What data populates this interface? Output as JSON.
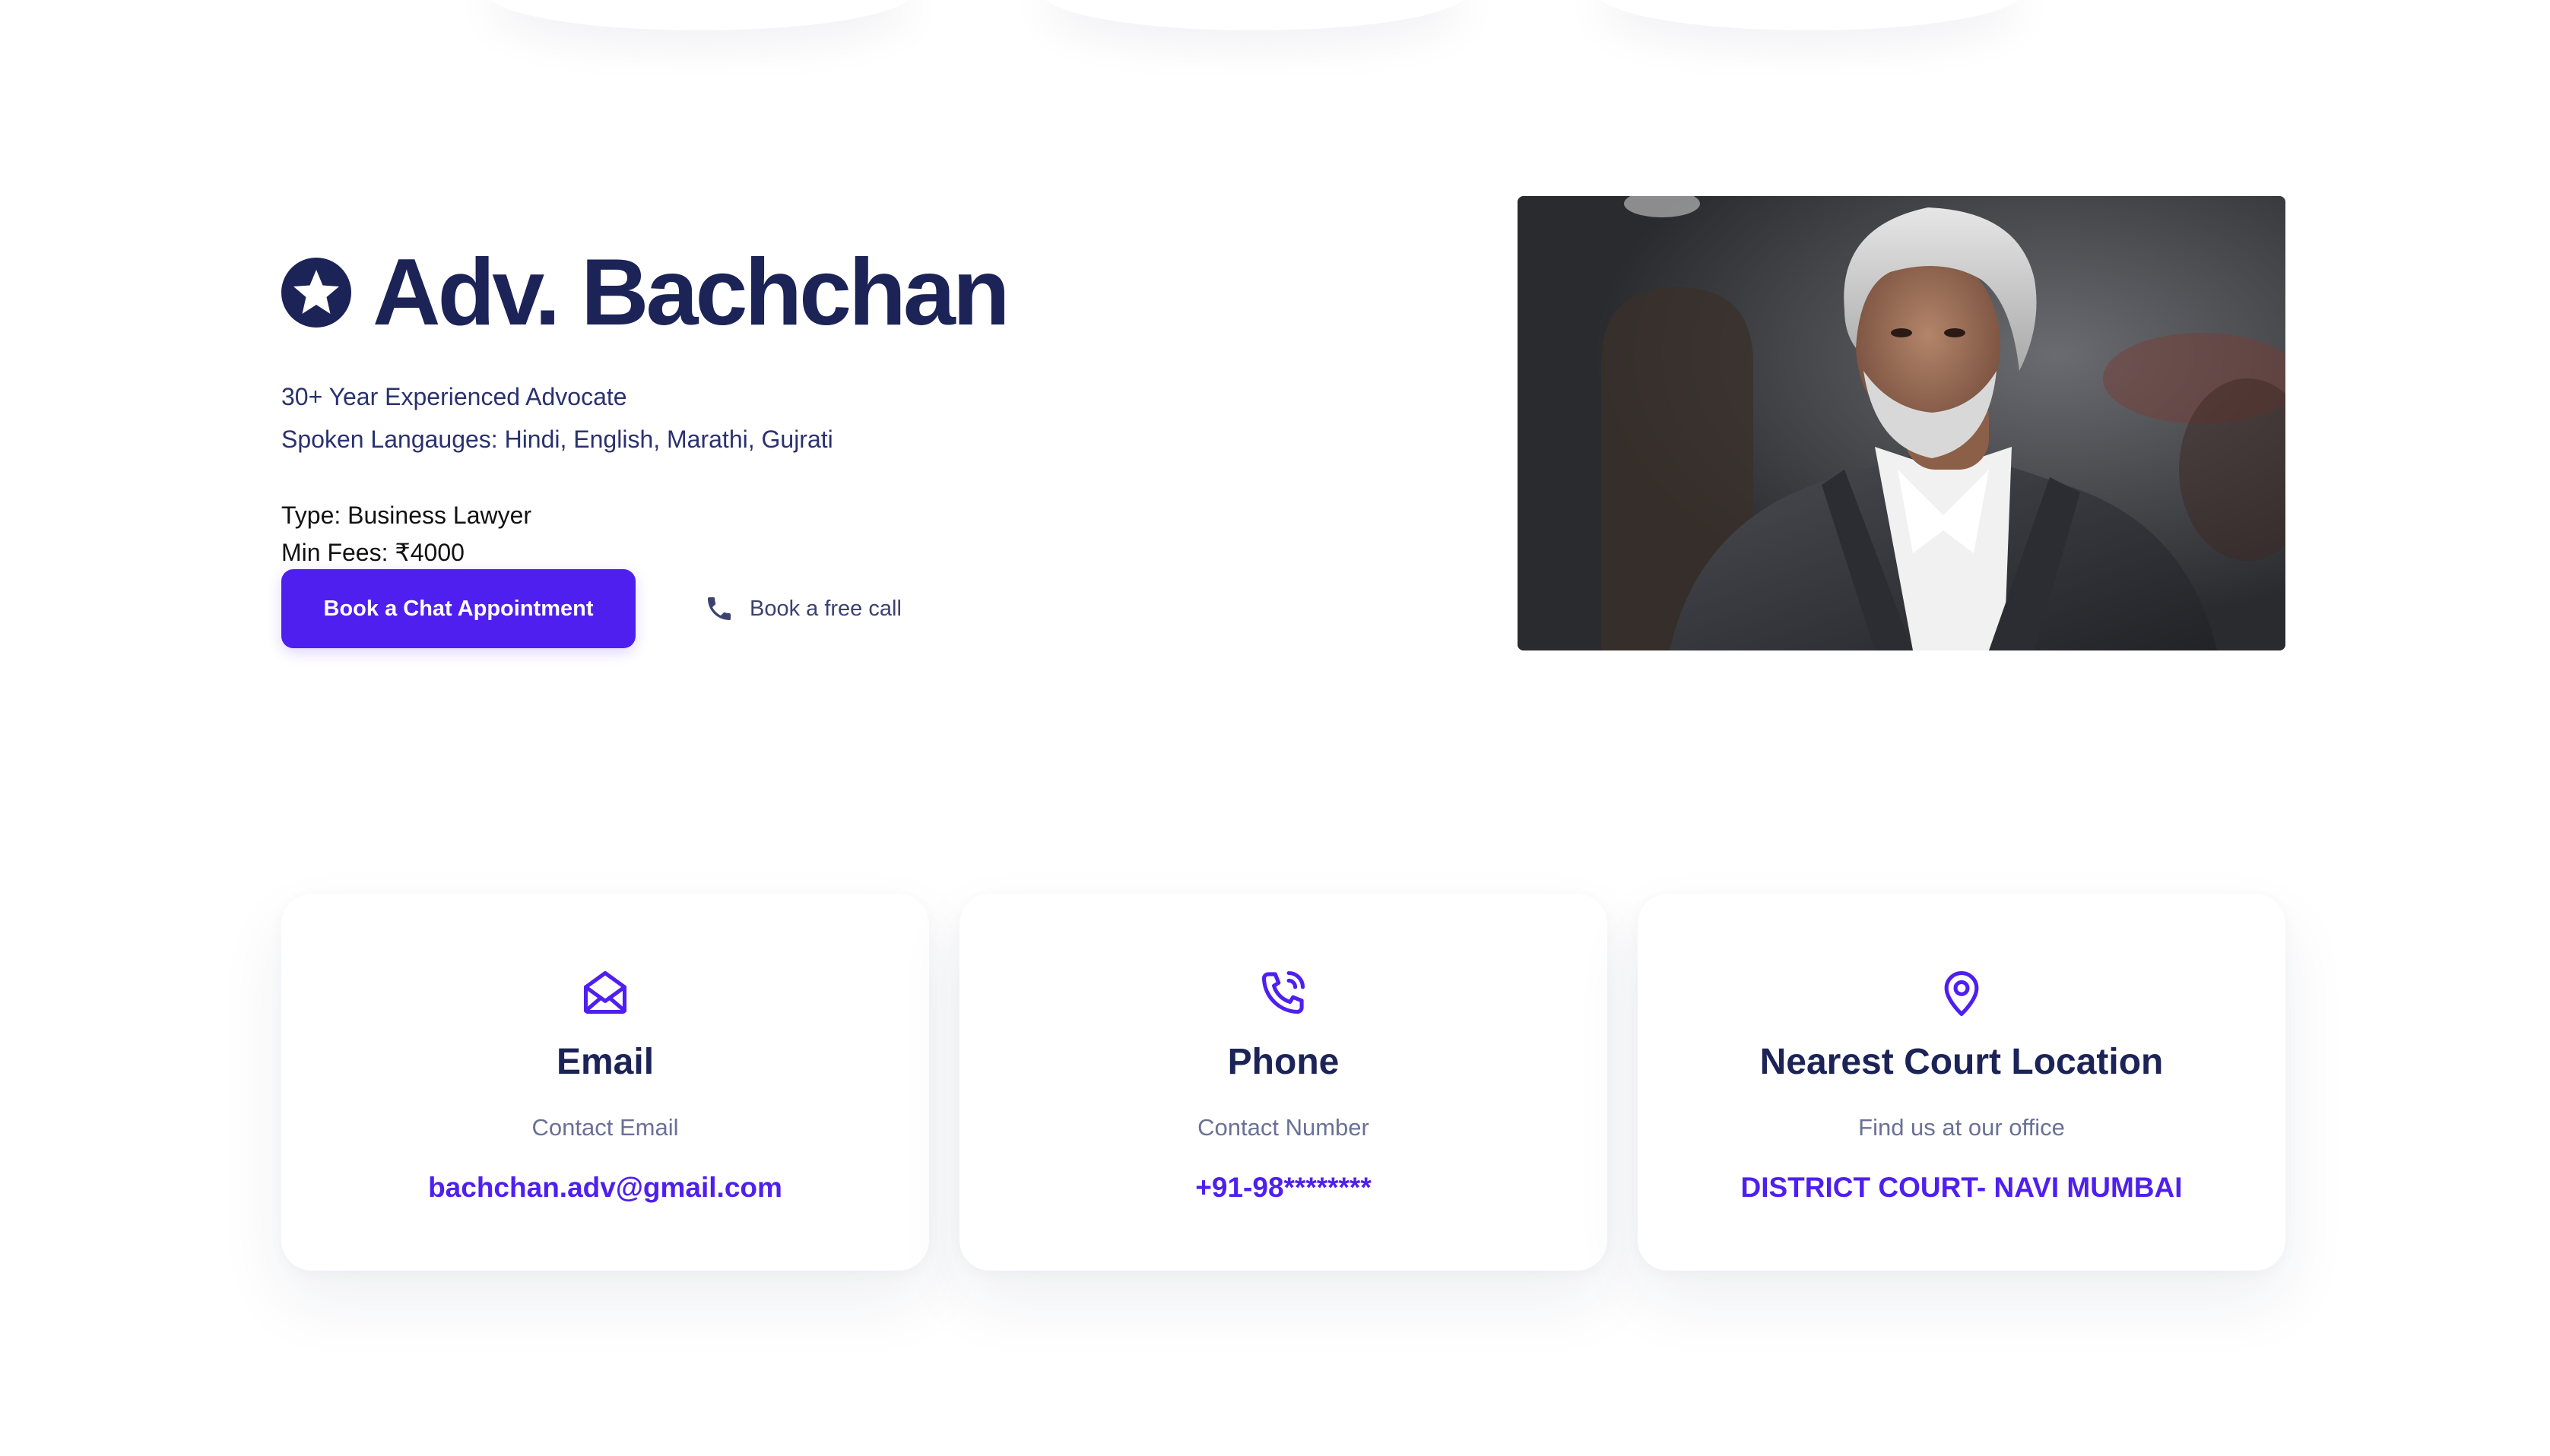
{
  "hero": {
    "title": "Adv. Bachchan",
    "experience": "30+ Year Experienced Advocate",
    "languages": "Spoken Langauges: Hindi, English, Marathi, Gujrati",
    "type": "Type: Business Lawyer",
    "fees": "Min Fees: ₹4000",
    "primary_button": "Book a Chat Appointment",
    "call_button": "Book a free call",
    "badge_icon": "star-badge-icon",
    "photo_icon": "lawyer-portrait"
  },
  "contact_cards": [
    {
      "icon": "mail-open-icon",
      "title": "Email",
      "subtitle": "Contact Email",
      "value": "bachchan.adv@gmail.com"
    },
    {
      "icon": "phone-ringing-icon",
      "title": "Phone",
      "subtitle": "Contact Number",
      "value": "+91-98********"
    },
    {
      "icon": "map-pin-icon",
      "title": "Nearest Court Location",
      "subtitle": "Find us at our office",
      "value": "DISTRICT COURT- NAVI MUMBAI"
    }
  ],
  "colors": {
    "accent": "#4f1fef",
    "heading": "#1c2357",
    "body_text": "#2a3170",
    "muted": "#6a7196"
  }
}
